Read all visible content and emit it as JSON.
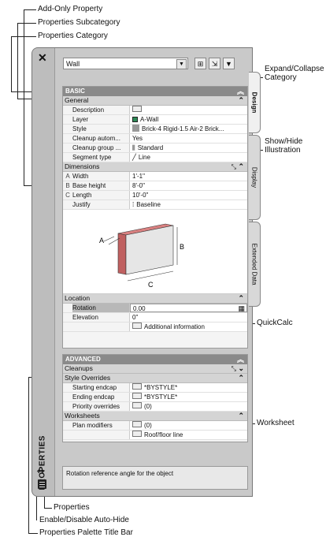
{
  "callouts": {
    "add_only": "Add-Only Property",
    "subcategory": "Properties Subcategory",
    "category": "Properties Category",
    "expand_collapse": "Expand/Collapse\nCategory",
    "show_hide": "Show/Hide\nIllustration",
    "quickcalc": "QuickCalc",
    "worksheet": "Worksheet",
    "properties": "Properties",
    "autohide": "Enable/Disable Auto-Hide",
    "titlebar": "Properties Palette Title Bar"
  },
  "palette": {
    "title": "PROPERTIES",
    "close": "✕",
    "object_type": "Wall",
    "tabs": [
      "Design",
      "Display",
      "Extended Data"
    ],
    "description": "Rotation reference angle for the object"
  },
  "basic": {
    "header": "BASIC",
    "general_label": "General",
    "general": [
      {
        "name": "Description",
        "value": ""
      },
      {
        "name": "Layer",
        "value": "A-Wall"
      },
      {
        "name": "Style",
        "value": "Brick-4 Rigid-1.5 Air-2 Brick..."
      },
      {
        "name": "Cleanup autom...",
        "value": "Yes"
      },
      {
        "name": "Cleanup group ...",
        "value": "Standard"
      },
      {
        "name": "Segment type",
        "value": "Line"
      }
    ],
    "dimensions_label": "Dimensions",
    "dimensions": [
      {
        "letter": "A",
        "name": "Width",
        "value": "1'-1\""
      },
      {
        "letter": "B",
        "name": "Base height",
        "value": "8'-0\""
      },
      {
        "letter": "C",
        "name": "Length",
        "value": "10'-0\""
      },
      {
        "letter": "",
        "name": "Justify",
        "value": "Baseline"
      }
    ],
    "illustration_labels": {
      "a": "A",
      "b": "B",
      "c": "C"
    },
    "location_label": "Location",
    "location": [
      {
        "name": "Rotation",
        "value": "0.00"
      },
      {
        "name": "Elevation",
        "value": "0\""
      },
      {
        "name": "",
        "value": "Additional information"
      }
    ]
  },
  "advanced": {
    "header": "ADVANCED",
    "cleanups_label": "Cleanups",
    "style_overrides_label": "Style Overrides",
    "style_overrides": [
      {
        "name": "Starting endcap",
        "value": "*BYSTYLE*"
      },
      {
        "name": "Ending endcap",
        "value": "*BYSTYLE*"
      },
      {
        "name": "Priority overrides",
        "value": "(0)"
      }
    ],
    "worksheets_label": "Worksheets",
    "worksheets": [
      {
        "name": "Plan modifiers",
        "value": "(0)"
      },
      {
        "name": "",
        "value": "Roof/floor line"
      }
    ]
  },
  "colors": {
    "layer_swatch": "#2e8b57",
    "wall_color": "#c06060",
    "header": "#8a8a8a"
  }
}
